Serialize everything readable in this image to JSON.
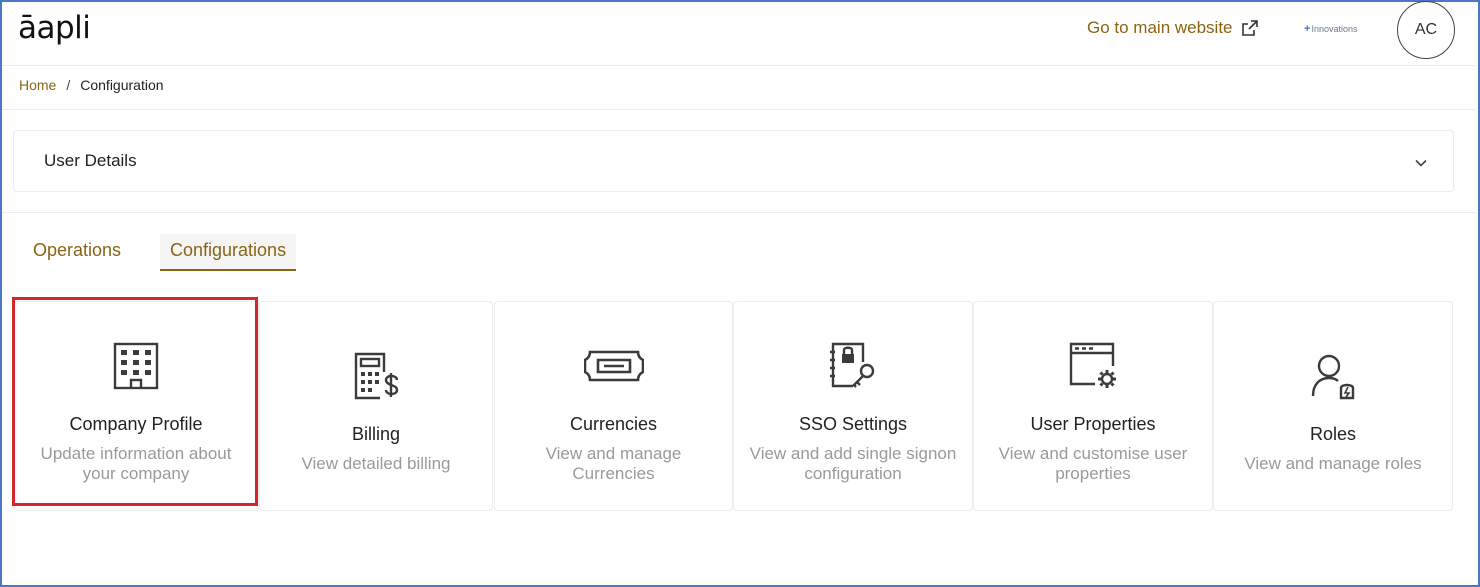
{
  "header": {
    "logo": "āapli",
    "goto_label": "Go to main website",
    "innovations_label": "Innovations",
    "avatar_initials": "AC"
  },
  "breadcrumb": {
    "home": "Home",
    "separator": "/",
    "current": "Configuration"
  },
  "accordion": {
    "title": "User Details"
  },
  "tabs": [
    {
      "label": "Operations",
      "active": false
    },
    {
      "label": "Configurations",
      "active": true
    }
  ],
  "cards": [
    {
      "title": "Company Profile",
      "description": "Update information about your company",
      "icon": "building-icon"
    },
    {
      "title": "Billing",
      "description": "View detailed billing",
      "icon": "billing-calculator-icon"
    },
    {
      "title": "Currencies",
      "description": "View and manage Currencies",
      "icon": "currency-note-icon"
    },
    {
      "title": "SSO Settings",
      "description": "View and add single signon configuration",
      "icon": "sso-lock-key-icon"
    },
    {
      "title": "User Properties",
      "description": "View and customise user properties",
      "icon": "window-gear-icon"
    },
    {
      "title": "Roles",
      "description": "View and manage roles",
      "icon": "user-role-icon"
    }
  ],
  "colors": {
    "accent": "#8a6414",
    "highlight": "#d6262b",
    "frame": "#4a78c4"
  }
}
